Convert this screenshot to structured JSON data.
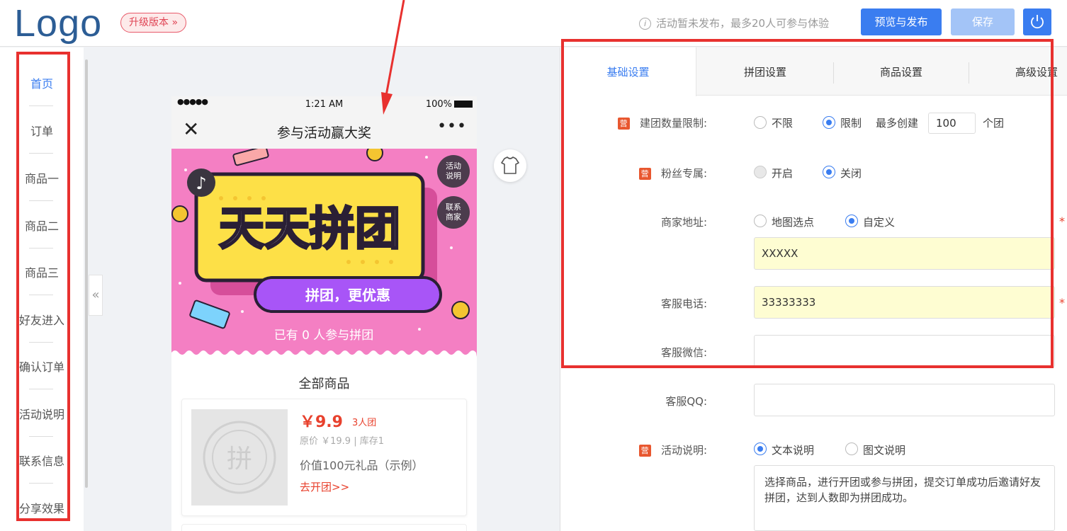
{
  "header": {
    "logo": "Logo",
    "upgrade_label": "升级版本 »",
    "notice_icon": "i",
    "notice": "活动暂未发布，最多20人可参与体验",
    "publish_label": "预览与发布",
    "save_label": "保存"
  },
  "sidebar": {
    "items": [
      {
        "label": "首页",
        "active": true
      },
      {
        "label": "订单"
      },
      {
        "label": "商品一"
      },
      {
        "label": "商品二"
      },
      {
        "label": "商品三"
      },
      {
        "label": "好友进入"
      },
      {
        "label": "确认订单"
      },
      {
        "label": "活动说明"
      },
      {
        "label": "联系信息"
      },
      {
        "label": "分享效果"
      }
    ],
    "collapse_label": "«"
  },
  "phone": {
    "status": {
      "dots": "●●●●●",
      "time": "1:21 AM",
      "battery": "100%"
    },
    "nav_close": "✕",
    "title": "参与活动赢大奖",
    "nav_more": "•••",
    "banner": {
      "headline": "天天拼团",
      "slogan": "拼团，更优惠",
      "participants": "已有 0 人参与拼团",
      "rules_button": "活动说明",
      "contact_button": "联系商家",
      "seal_char": "拼"
    },
    "section_title": "全部商品",
    "product": {
      "price": "￥9.9",
      "group_size": "3人团",
      "original": "原价 ￥19.9 | 库存1",
      "name": "价值100元礼品（示例）",
      "action": "去开团>>"
    }
  },
  "panel": {
    "tabs": [
      "基础设置",
      "拼团设置",
      "商品设置",
      "高级设置"
    ],
    "active_tab": 0,
    "badge": "营",
    "fields": {
      "group_limit": {
        "label": "建团数量限制:",
        "opt1": "不限",
        "opt2": "限制",
        "selected": 1,
        "prefix": "最多创建",
        "value": "100",
        "suffix": "个团"
      },
      "fans_only": {
        "label": "粉丝专属:",
        "opt1": "开启",
        "opt2": "关闭",
        "selected": 1
      },
      "address": {
        "label": "商家地址:",
        "opt1": "地图选点",
        "opt2": "自定义",
        "selected": 1,
        "value": "XXXXX"
      },
      "phone": {
        "label": "客服电话:",
        "value": "33333333"
      },
      "wechat": {
        "label": "客服微信:",
        "value": ""
      },
      "qq": {
        "label": "客服QQ:",
        "value": ""
      },
      "desc": {
        "label": "活动说明:",
        "opt1": "文本说明",
        "opt2": "图文说明",
        "selected": 0,
        "text": "选择商品，进行开团或参与拼团，提交订单成功后邀请好友拼团，达到人数即为拼团成功。"
      }
    },
    "required_mark": "*"
  },
  "colors": {
    "accent": "#3a7df0",
    "highlight": "#e8312f",
    "price": "#e8412d",
    "banner_pink": "#f47fc3",
    "banner_yellow": "#fde047"
  }
}
